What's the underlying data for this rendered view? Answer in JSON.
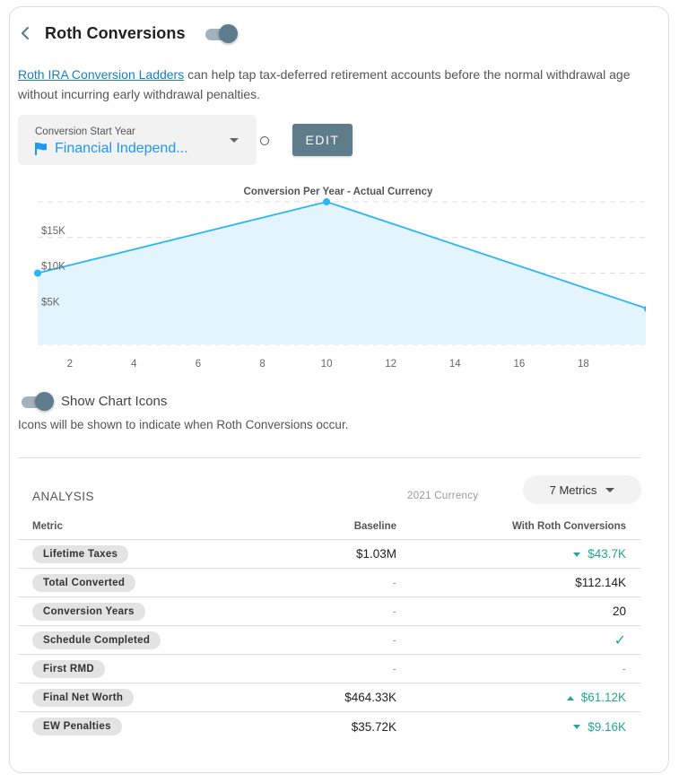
{
  "header": {
    "title": "Roth Conversions",
    "back_icon": "chevron-left-icon",
    "enabled": true
  },
  "description": {
    "link_text": "Roth IRA Conversion Ladders",
    "text": " can help tap tax-deferred retirement accounts before the normal withdrawal age without incurring early withdrawal penalties."
  },
  "start_year": {
    "label": "Conversion Start Year",
    "value": "Financial Independ...",
    "icon": "flag-icon",
    "edit_label": "EDIT"
  },
  "chart_data": {
    "type": "area",
    "title": "Conversion Per Year - Actual Currency",
    "xlabel": "",
    "ylabel": "",
    "x": [
      1,
      10,
      20
    ],
    "series": [
      {
        "name": "Conversion Per Year",
        "values": [
          10000,
          20000,
          5000
        ]
      }
    ],
    "xlim": [
      1,
      20
    ],
    "ylim": [
      0,
      20000
    ],
    "xticks": [
      2,
      4,
      6,
      8,
      10,
      12,
      14,
      16,
      18
    ],
    "yticks": [
      {
        "value": 5000,
        "label": "$5K"
      },
      {
        "value": 10000,
        "label": "$10K"
      },
      {
        "value": 15000,
        "label": "$15K"
      }
    ],
    "gridlines": [
      0,
      5000,
      10000,
      15000,
      20000
    ],
    "grid": true,
    "colors": {
      "line": "#29b6f6",
      "fill": "#e3f4fc"
    }
  },
  "chart_icons": {
    "label": "Show Chart Icons",
    "enabled": true,
    "description": "Icons will be shown to indicate when Roth Conversions occur."
  },
  "analysis": {
    "title": "ANALYSIS",
    "currency": "2021 Currency",
    "metrics_button": "7 Metrics",
    "columns": [
      "Metric",
      "Baseline",
      "With Roth Conversions"
    ],
    "rows": [
      {
        "metric": "Lifetime Taxes",
        "baseline": "$1.03M",
        "roth": "$43.7K",
        "trend": "down"
      },
      {
        "metric": "Total Converted",
        "baseline": "-",
        "roth": "$112.14K",
        "trend": "none"
      },
      {
        "metric": "Conversion Years",
        "baseline": "-",
        "roth": "20",
        "trend": "none"
      },
      {
        "metric": "Schedule Completed",
        "baseline": "-",
        "roth": "✓",
        "trend": "check"
      },
      {
        "metric": "First RMD",
        "baseline": "-",
        "roth": "-",
        "trend": "dash"
      },
      {
        "metric": "Final Net Worth",
        "baseline": "$464.33K",
        "roth": "$61.12K",
        "trend": "up"
      },
      {
        "metric": "EW Penalties",
        "baseline": "$35.72K",
        "roth": "$9.16K",
        "trend": "down"
      }
    ]
  },
  "colors": {
    "accent": "#5f7c8b",
    "link": "#1a7cc9",
    "select_value": "#2196f3",
    "positive": "#26a69a"
  }
}
